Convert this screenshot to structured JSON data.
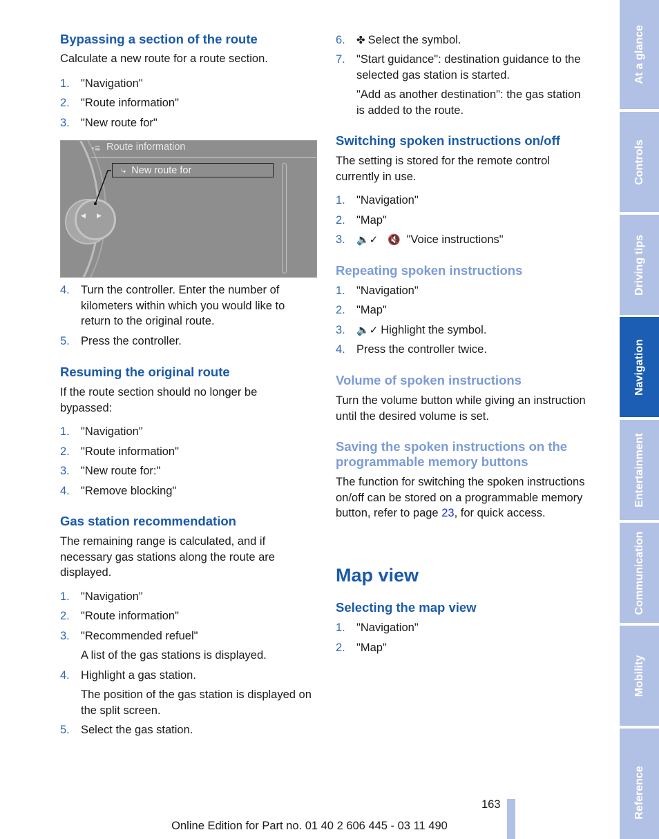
{
  "left_column": {
    "bypass": {
      "heading": "Bypassing a section of the route",
      "intro": "Calculate a new route for a route section.",
      "steps": [
        {
          "num": "1.",
          "text": "\"Navigation\""
        },
        {
          "num": "2.",
          "text": "\"Route information\""
        },
        {
          "num": "3.",
          "text": "\"New route for\""
        }
      ],
      "screen": {
        "header_icon": "route-info-icon",
        "header": "Route information",
        "selected_icon": "new-route-icon",
        "selected_item": "New route for"
      },
      "steps_after": [
        {
          "num": "4.",
          "text": "Turn the controller. Enter the number of kilometers within which you would like to return to the original route."
        },
        {
          "num": "5.",
          "text": "Press the controller."
        }
      ]
    },
    "resume": {
      "heading": "Resuming the original route",
      "intro": "If the route section should no longer be bypassed:",
      "steps": [
        {
          "num": "1.",
          "text": "\"Navigation\""
        },
        {
          "num": "2.",
          "text": "\"Route information\""
        },
        {
          "num": "3.",
          "text": "\"New route for:\""
        },
        {
          "num": "4.",
          "text": "\"Remove blocking\""
        }
      ]
    },
    "gas": {
      "heading": "Gas station recommendation",
      "intro": "The remaining range is calculated, and if necessary gas stations along the route are displayed.",
      "steps": [
        {
          "num": "1.",
          "text": "\"Navigation\""
        },
        {
          "num": "2.",
          "text": "\"Route information\""
        },
        {
          "num": "3.",
          "text": "\"Recommended refuel\"",
          "note": "A list of the gas stations is displayed."
        },
        {
          "num": "4.",
          "text": "Highlight a gas station.",
          "note": "The position of the gas station is displayed on the split screen."
        },
        {
          "num": "5.",
          "text": "Select the gas station."
        }
      ]
    }
  },
  "right_column": {
    "gas_cont": {
      "steps": [
        {
          "num": "6.",
          "icon": "destination-flag-icon",
          "text": "Select the symbol."
        },
        {
          "num": "7.",
          "text": "\"Start guidance\": destination guidance to the selected gas station is started.",
          "note": "\"Add as another destination\": the gas station is added to the route."
        }
      ]
    },
    "switching": {
      "heading": "Switching spoken instructions on/off",
      "intro": "The setting is stored for the remote control currently in use.",
      "steps": [
        {
          "num": "1.",
          "text": "\"Navigation\""
        },
        {
          "num": "2.",
          "text": "\"Map\""
        },
        {
          "num": "3.",
          "icon": "voice-on-icon",
          "icon2": "voice-off-icon",
          "text": "\"Voice instructions\""
        }
      ]
    },
    "repeating": {
      "heading": "Repeating spoken instructions",
      "steps": [
        {
          "num": "1.",
          "text": "\"Navigation\""
        },
        {
          "num": "2.",
          "text": "\"Map\""
        },
        {
          "num": "3.",
          "icon": "voice-on-icon",
          "text": "Highlight the symbol."
        },
        {
          "num": "4.",
          "text": "Press the controller twice."
        }
      ]
    },
    "volume": {
      "heading": "Volume of spoken instructions",
      "text": "Turn the volume button while giving an instruction until the desired volume is set."
    },
    "saving": {
      "heading_line1": "Saving the spoken instructions on the",
      "heading_line2": "programmable memory buttons",
      "text_before": "The function for switching the spoken instructions on/off can be stored on a programmable memory button, refer to page ",
      "link": "23",
      "text_after": ", for quick access."
    },
    "map_view": {
      "title": "Map view",
      "heading": "Selecting the map view",
      "steps": [
        {
          "num": "1.",
          "text": "\"Navigation\""
        },
        {
          "num": "2.",
          "text": "\"Map\""
        }
      ]
    }
  },
  "side_tabs": [
    {
      "label": "At a glance",
      "active": false
    },
    {
      "label": "Controls",
      "active": false
    },
    {
      "label": "Driving tips",
      "active": false
    },
    {
      "label": "Navigation",
      "active": true
    },
    {
      "label": "Entertainment",
      "active": false
    },
    {
      "label": "Communication",
      "active": false
    },
    {
      "label": "Mobility",
      "active": false
    },
    {
      "label": "Reference",
      "active": false
    }
  ],
  "page_number": "163",
  "footer": "Online Edition for Part no. 01 40 2 606 445 - 03 11 490",
  "colors": {
    "heading_blue": "#1a5aaa",
    "heading_light_blue": "#7b9bd6",
    "tab_inactive": "#b1c1e5",
    "tab_active": "#1b5eb4",
    "link": "#1b2fe0"
  }
}
